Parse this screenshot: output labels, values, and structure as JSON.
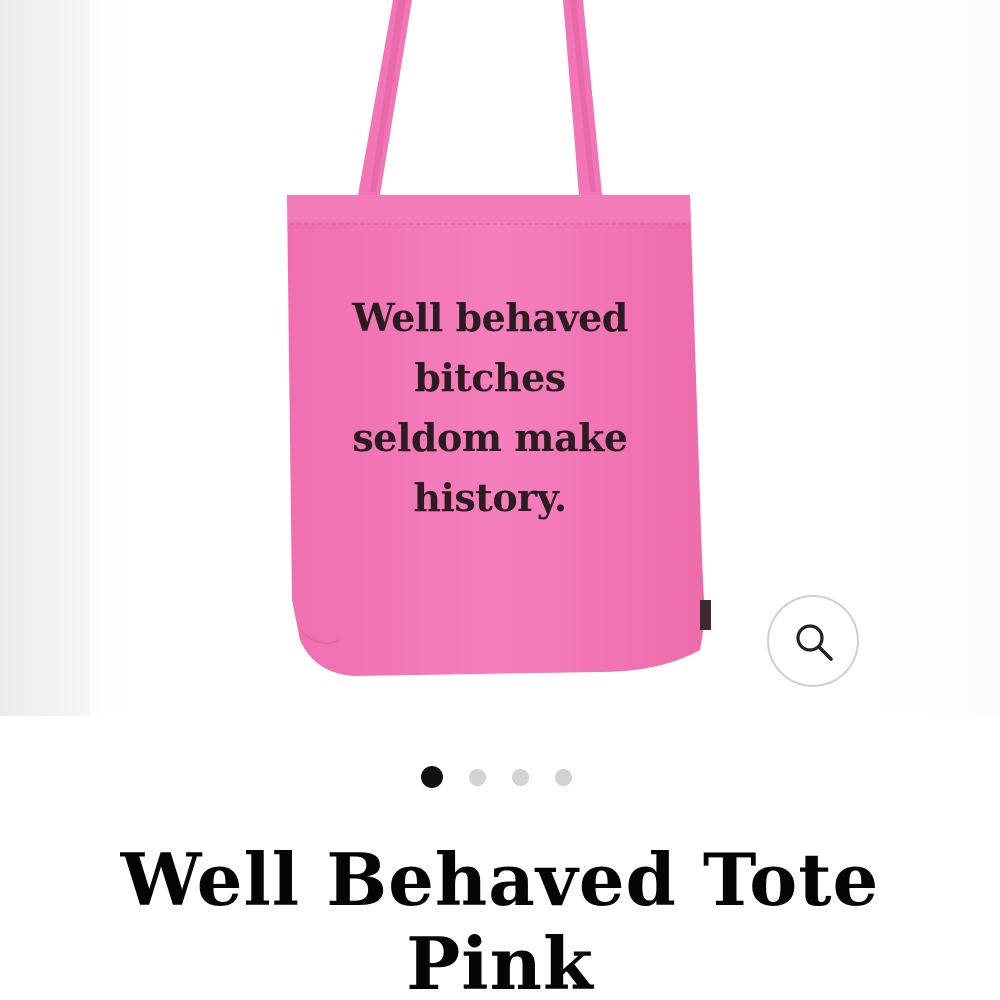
{
  "gallery": {
    "tote_print_lines": [
      "Well behaved",
      "bitches",
      "seldom make",
      "history."
    ],
    "tote_color": "#f47ab8",
    "print_color": "#2b1c22",
    "zoom_icon": "search-icon",
    "slide_count": 4,
    "active_slide": 1
  },
  "product": {
    "title_line1": "Well Behaved Tote",
    "title_line2": "Pink"
  }
}
